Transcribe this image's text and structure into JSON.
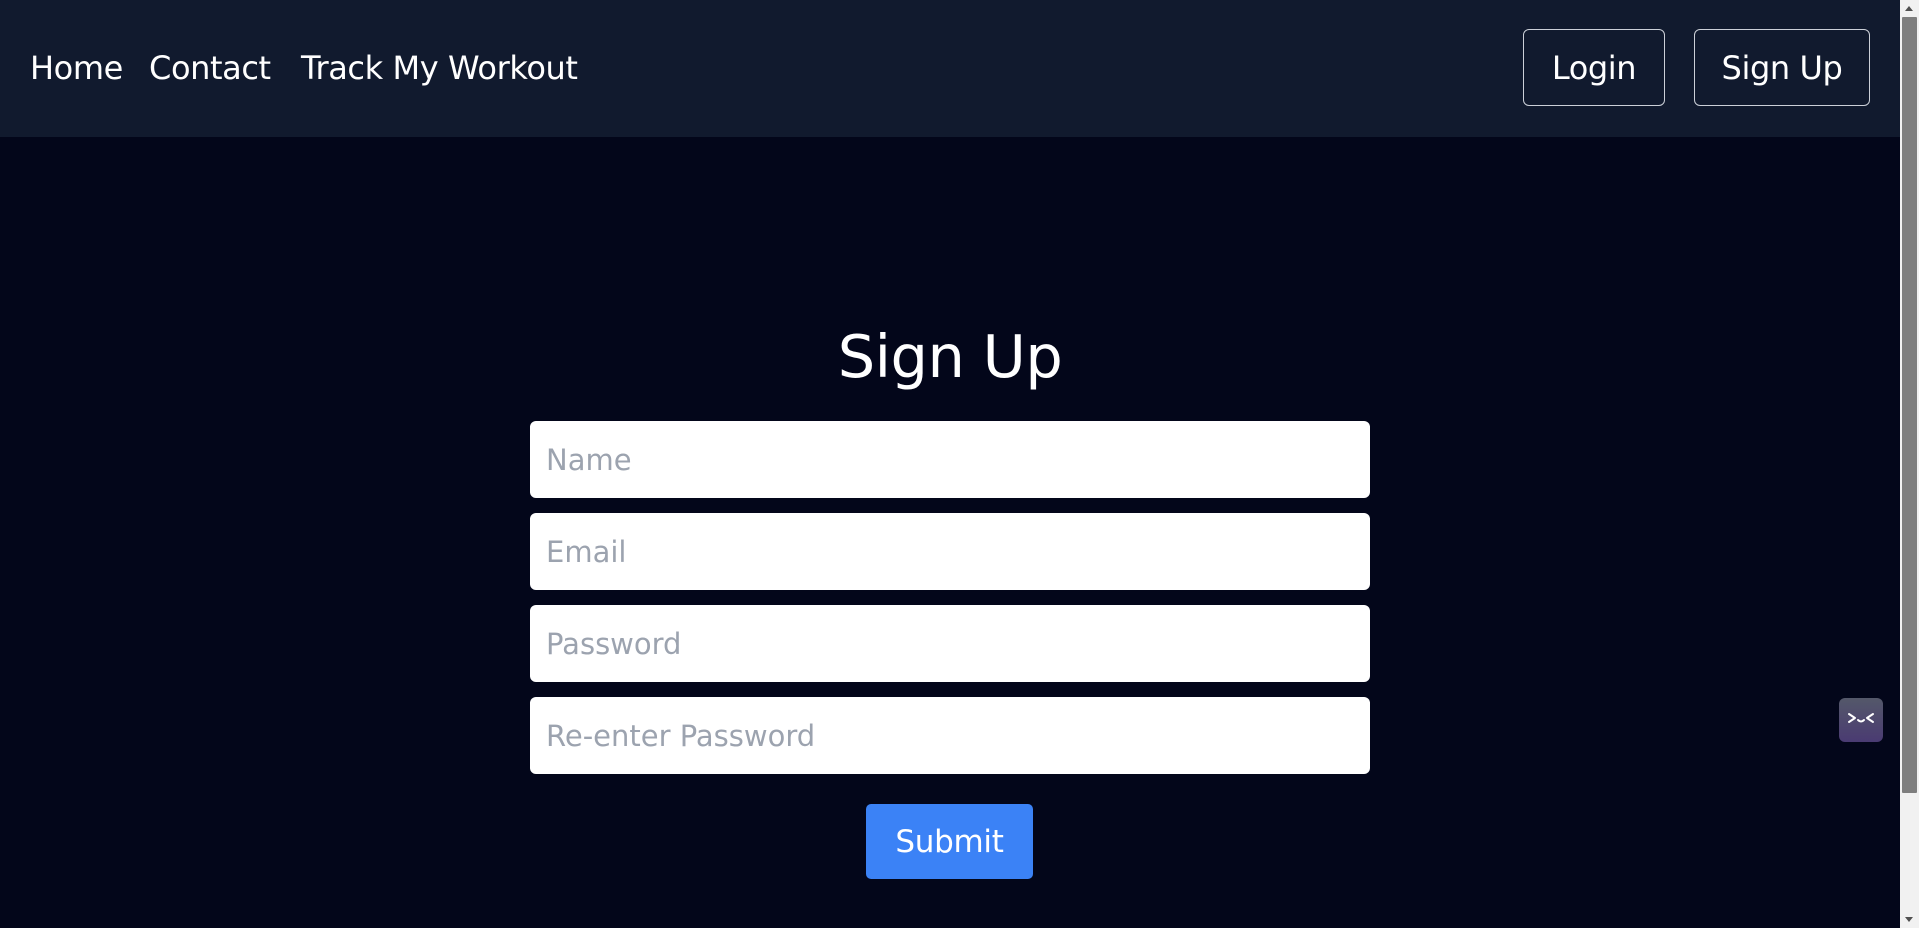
{
  "nav": {
    "links": [
      "Home",
      "Contact",
      "Track My Workout"
    ],
    "login_label": "Login",
    "signup_label": "Sign Up"
  },
  "form": {
    "title": "Sign Up",
    "fields": [
      {
        "placeholder": "Name",
        "value": ""
      },
      {
        "placeholder": "Email",
        "value": ""
      },
      {
        "placeholder": "Password",
        "value": ""
      },
      {
        "placeholder": "Re-enter Password",
        "value": ""
      }
    ],
    "submit_label": "Submit"
  },
  "widget": {
    "icon": "terminal-face-icon"
  },
  "colors": {
    "page_background": "#03061a",
    "navbar_background": "#111a2e",
    "accent": "#3b82f6",
    "placeholder_text": "#9ca3af"
  }
}
